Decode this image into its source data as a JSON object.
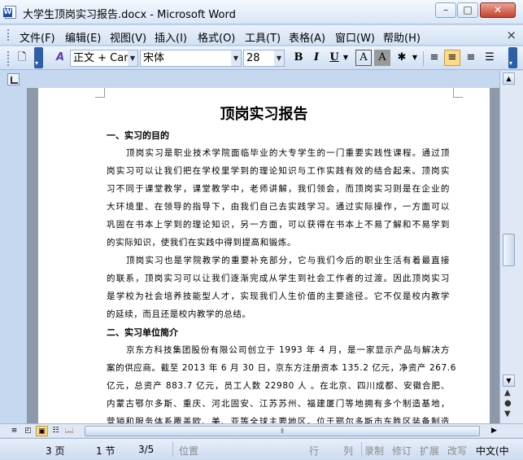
{
  "window": {
    "title": "大学生顶岗实习报告.docx - Microsoft Word",
    "minimize": "–",
    "maximize": "□",
    "close": "✕"
  },
  "menu": {
    "items": [
      {
        "label": "文件(F)"
      },
      {
        "label": "编辑(E)"
      },
      {
        "label": "视图(V)"
      },
      {
        "label": "插入(I)"
      },
      {
        "label": "格式(O)"
      },
      {
        "label": "工具(T)"
      },
      {
        "label": "表格(A)"
      },
      {
        "label": "窗口(W)"
      },
      {
        "label": "帮助(H)"
      }
    ],
    "close_doc": "×"
  },
  "toolbar": {
    "style_value": "正文 + Car",
    "font_value": "宋体",
    "size_value": "28",
    "bold": "B",
    "italic": "I",
    "underline": "U",
    "font_color_a": "A",
    "char_shading_a": "A"
  },
  "document": {
    "title": "顶岗实习报告",
    "section1_heading": "一、实习的目的",
    "section1_lines": [
      "顶岗实习是职业技术学院面临毕业的大专学生的一门重要实践性课程。通过顶",
      "岗实习可以让我们把在学校里学到的理论知识与工作实践有效的结合起来。顶岗实",
      "习不同于课堂教学，课堂教学中，老师讲解，我们领会，而顶岗实习则是在企业的",
      "大环境里、在领导的指导下，由我们自己去实践学习。通过实际操作，一方面可以",
      "巩固在书本上学到的理论知识，另一方面，可以获得在书本上不易了解和不易学到",
      "的实际知识，使我们在实践中得到提高和锻炼。"
    ],
    "section1_para2": [
      "顶岗实习也是学院教学的重要补充部分，它与我们今后的职业生活有着最直接",
      "的联系，顶岗实习可以让我们逐渐完成从学生到社会工作者的过渡。因此顶岗实习",
      "是学校为社会培养技能型人才，实现我们人生价值的主要途径。它不仅是校内教学",
      "的延续，而且还是校内教学的总结。"
    ],
    "section2_heading": "二、实习单位简介",
    "section2_lines": [
      "京东方科技集团股份有限公司创立于 1993 年 4 月，是一家显示产品与解决方",
      "案的供应商。截至 2013 年 6 月 30 日，京东方注册资本 135.2 亿元，净资产 267.6",
      "亿元，总资产 883.7 亿元，员工人数 22980 人 。在北京、四川成都、安徽合肥、",
      "内蒙古鄂尔多斯、重庆、河北固安、江苏苏州、福建厦门等地拥有多个制造基地，",
      "营销和服务体系覆盖欧、美、亚等全球主要地区。位于鄂尔多斯市东胜区装备制造"
    ]
  },
  "status": {
    "page": "3 页",
    "section": "1 节",
    "page_of": "3/5",
    "position": "位置",
    "line": "行",
    "column": "列",
    "record": "录制",
    "revision": "修订",
    "extend": "扩展",
    "overtype": "改写",
    "language": "中文(中"
  },
  "colors": {
    "frame": "#c5d8ef",
    "highlight": "#fdd98b"
  },
  "icons": [
    "word-doc-icon",
    "new-document-icon",
    "styles-pane-icon",
    "align-left-icon",
    "center-icon",
    "align-right-icon",
    "justify-icon",
    "highlight-icon"
  ]
}
